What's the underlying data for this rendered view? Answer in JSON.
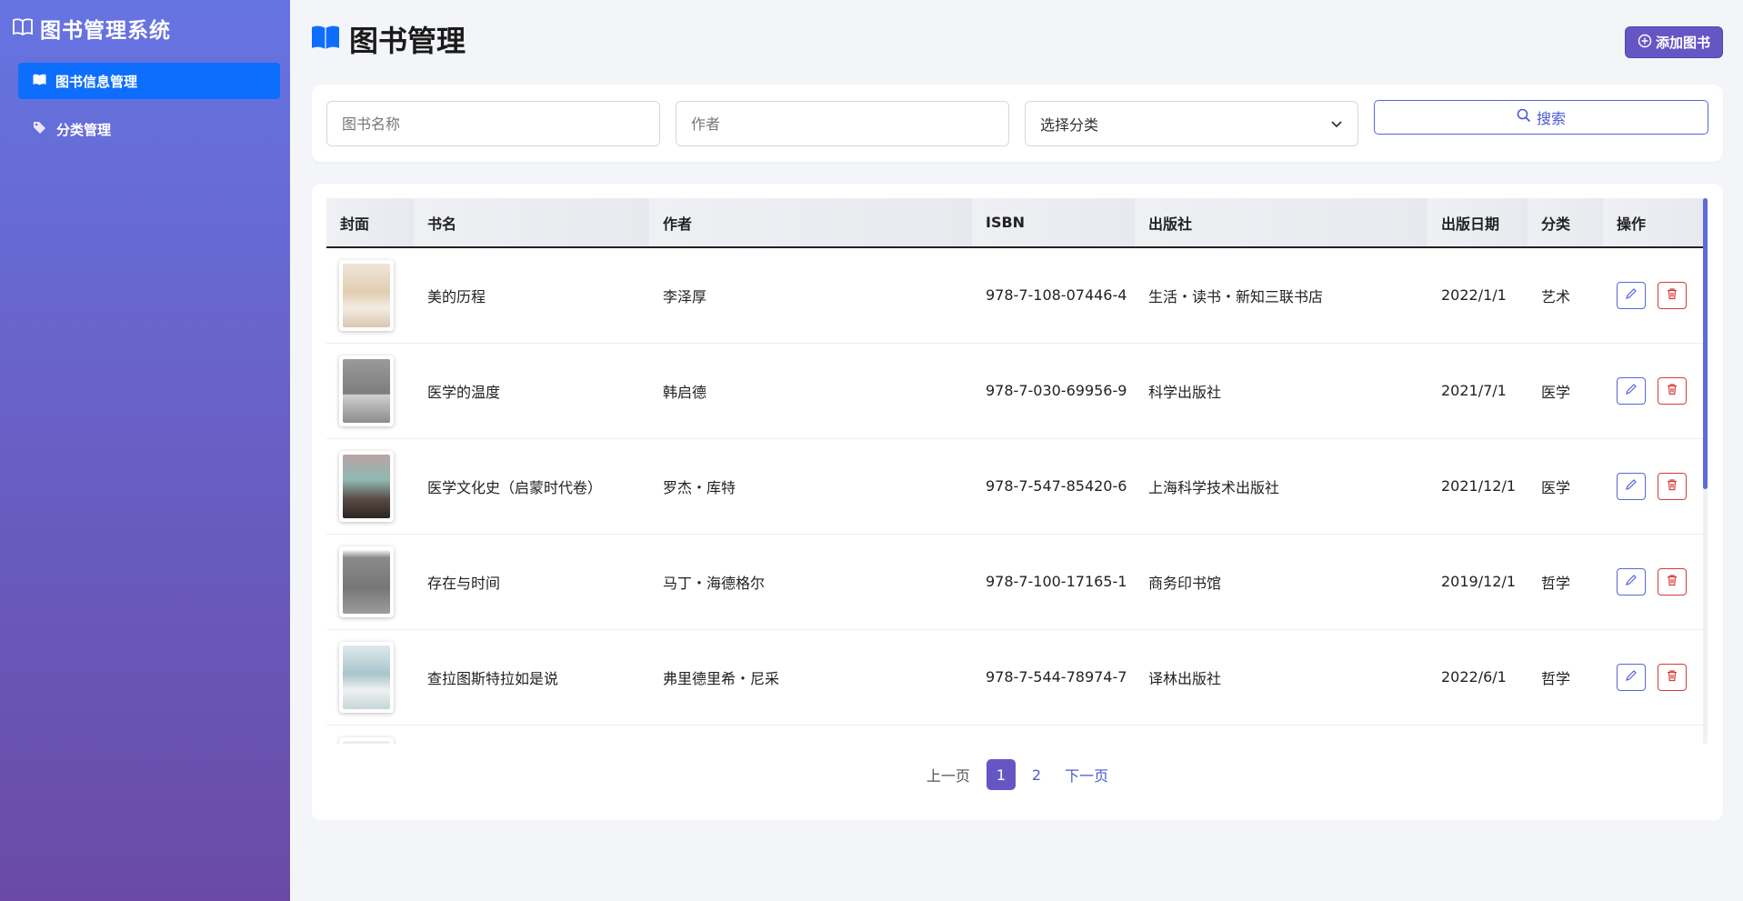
{
  "sidebar": {
    "brand": "图书管理系统",
    "items": [
      {
        "label": "图书信息管理",
        "icon": "book-icon",
        "active": true
      },
      {
        "label": "分类管理",
        "icon": "tags-icon",
        "active": false
      }
    ]
  },
  "header": {
    "title": "图书管理",
    "add_label": "添加图书"
  },
  "search": {
    "name_placeholder": "图书名称",
    "author_placeholder": "作者",
    "category_selected": "选择分类",
    "button_label": "搜索"
  },
  "table": {
    "columns": [
      "封面",
      "书名",
      "作者",
      "ISBN",
      "出版社",
      "出版日期",
      "分类",
      "操作"
    ],
    "rows": [
      {
        "title": "美的历程",
        "author": "李泽厚",
        "isbn": "978-7-108-07446-4",
        "publisher": "生活・读书・新知三联书店",
        "date": "2022/1/1",
        "category": "艺术"
      },
      {
        "title": "医学的温度",
        "author": "韩启德",
        "isbn": "978-7-030-69956-9",
        "publisher": "科学出版社",
        "date": "2021/7/1",
        "category": "医学"
      },
      {
        "title": "医学文化史（启蒙时代卷）",
        "author": "罗杰・库特",
        "isbn": "978-7-547-85420-6",
        "publisher": "上海科学技术出版社",
        "date": "2021/12/1",
        "category": "医学"
      },
      {
        "title": "存在与时间",
        "author": "马丁・海德格尔",
        "isbn": "978-7-100-17165-1",
        "publisher": "商务印书馆",
        "date": "2019/12/1",
        "category": "哲学"
      },
      {
        "title": "查拉图斯特拉如是说",
        "author": "弗里德里希・尼采",
        "isbn": "978-7-544-78974-7",
        "publisher": "译林出版社",
        "date": "2022/6/1",
        "category": "哲学"
      },
      {
        "title": "",
        "author": "",
        "isbn": "",
        "publisher": "",
        "date": "",
        "category": ""
      }
    ]
  },
  "pagination": {
    "prev": "上一页",
    "pages": [
      "1",
      "2"
    ],
    "current": "1",
    "next": "下一页"
  },
  "colors": {
    "accent": "#6656c4",
    "primary": "#0d6efd",
    "link": "#4a5bd0",
    "danger": "#d63a3a"
  }
}
